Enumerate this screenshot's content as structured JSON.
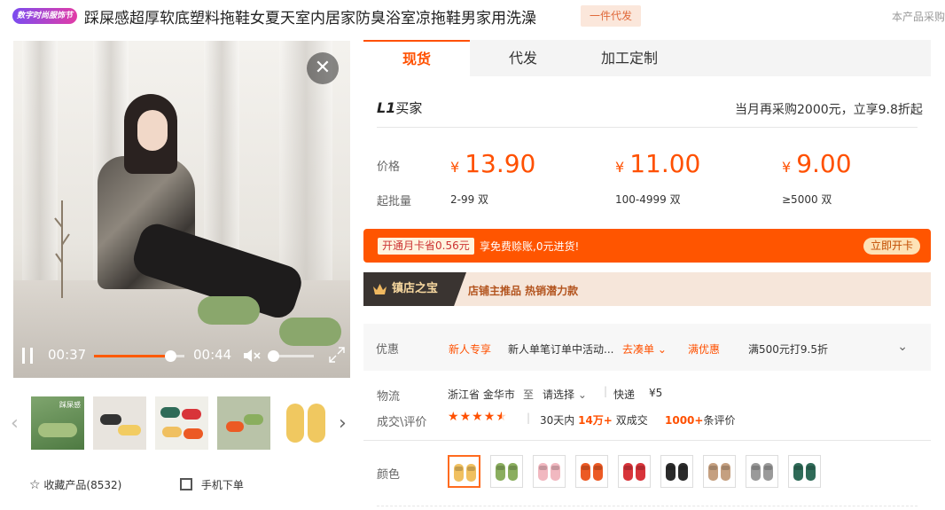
{
  "header": {
    "festival_badge": "数字时尚服饰节",
    "title": "踩屎感超厚软底塑料拖鞋女夏天室内居家防臭浴室凉拖鞋男家用洗澡",
    "dropship_badge": "一件代发",
    "right_note": "本产品采购"
  },
  "video": {
    "current_time": "00:37",
    "total_time": "00:44",
    "progress": 0.84,
    "volume": 0.0
  },
  "thumbnails": [
    {
      "name": "thumb-green-slippers",
      "caption": "踩屎感"
    },
    {
      "name": "thumb-yellow-slippers",
      "caption": ""
    },
    {
      "name": "thumb-multi-color-slippers",
      "caption": ""
    },
    {
      "name": "thumb-orange-slippers",
      "caption": ""
    },
    {
      "name": "thumb-yellow-pair",
      "caption": ""
    }
  ],
  "actions": {
    "favorite": "收藏产品(8532)",
    "mobile_order": "手机下单"
  },
  "tabs": [
    {
      "label": "现货",
      "active": true
    },
    {
      "label": "代发",
      "active": false
    },
    {
      "label": "加工定制",
      "active": false
    }
  ],
  "buyer_level": {
    "logo": "L1",
    "suffix": "买家",
    "note": "当月再采购2000元，立享9.8折起"
  },
  "pricing": {
    "price_label": "价格",
    "moq_label": "起批量",
    "currency": "¥",
    "tiers": [
      {
        "price": "13.90",
        "moq": "2-99 双"
      },
      {
        "price": "11.00",
        "moq": "100-4999 双"
      },
      {
        "price": "9.00",
        "moq": "≥5000 双"
      }
    ]
  },
  "member": {
    "chip": "开通月卡省0.56元",
    "text": "享免费赊账,0元进货!",
    "button": "立即开卡"
  },
  "treasure": {
    "tag": "镇店之宝",
    "text": "店铺主推品   热销潜力款"
  },
  "promo": {
    "label": "优惠",
    "new_user": "新人专享",
    "new_user_desc": "新人单笔订单中活动...",
    "collect": "去凑单",
    "full_discount": "满优惠",
    "full_discount_desc": "满500元打9.5折"
  },
  "logistics": {
    "label": "物流",
    "from": "浙江省 金华市",
    "to_label": "至",
    "to": "请选择",
    "method": "快递",
    "fee": "¥5"
  },
  "deals": {
    "label": "成交\\评价",
    "rating": 4.5,
    "days_label": "30天内",
    "deal_count": "14万+",
    "deal_suffix": "双成交",
    "review_count": "1000+",
    "review_suffix": "条评价"
  },
  "colors": {
    "label": "颜色",
    "swatches": [
      {
        "name": "yellow",
        "hex": "#f0c060",
        "selected": true
      },
      {
        "name": "green",
        "hex": "#8aae5e",
        "selected": false
      },
      {
        "name": "pink",
        "hex": "#f1b8c0",
        "selected": false
      },
      {
        "name": "orange",
        "hex": "#ec5a24",
        "selected": false
      },
      {
        "name": "red",
        "hex": "#d8343a",
        "selected": false
      },
      {
        "name": "black",
        "hex": "#2b2b2b",
        "selected": false
      },
      {
        "name": "khaki",
        "hex": "#c5a080",
        "selected": false
      },
      {
        "name": "gray",
        "hex": "#9a9a9a",
        "selected": false
      },
      {
        "name": "dark-green",
        "hex": "#2f6b58",
        "selected": false
      }
    ]
  },
  "theme": {
    "accent": "#ff5000"
  }
}
